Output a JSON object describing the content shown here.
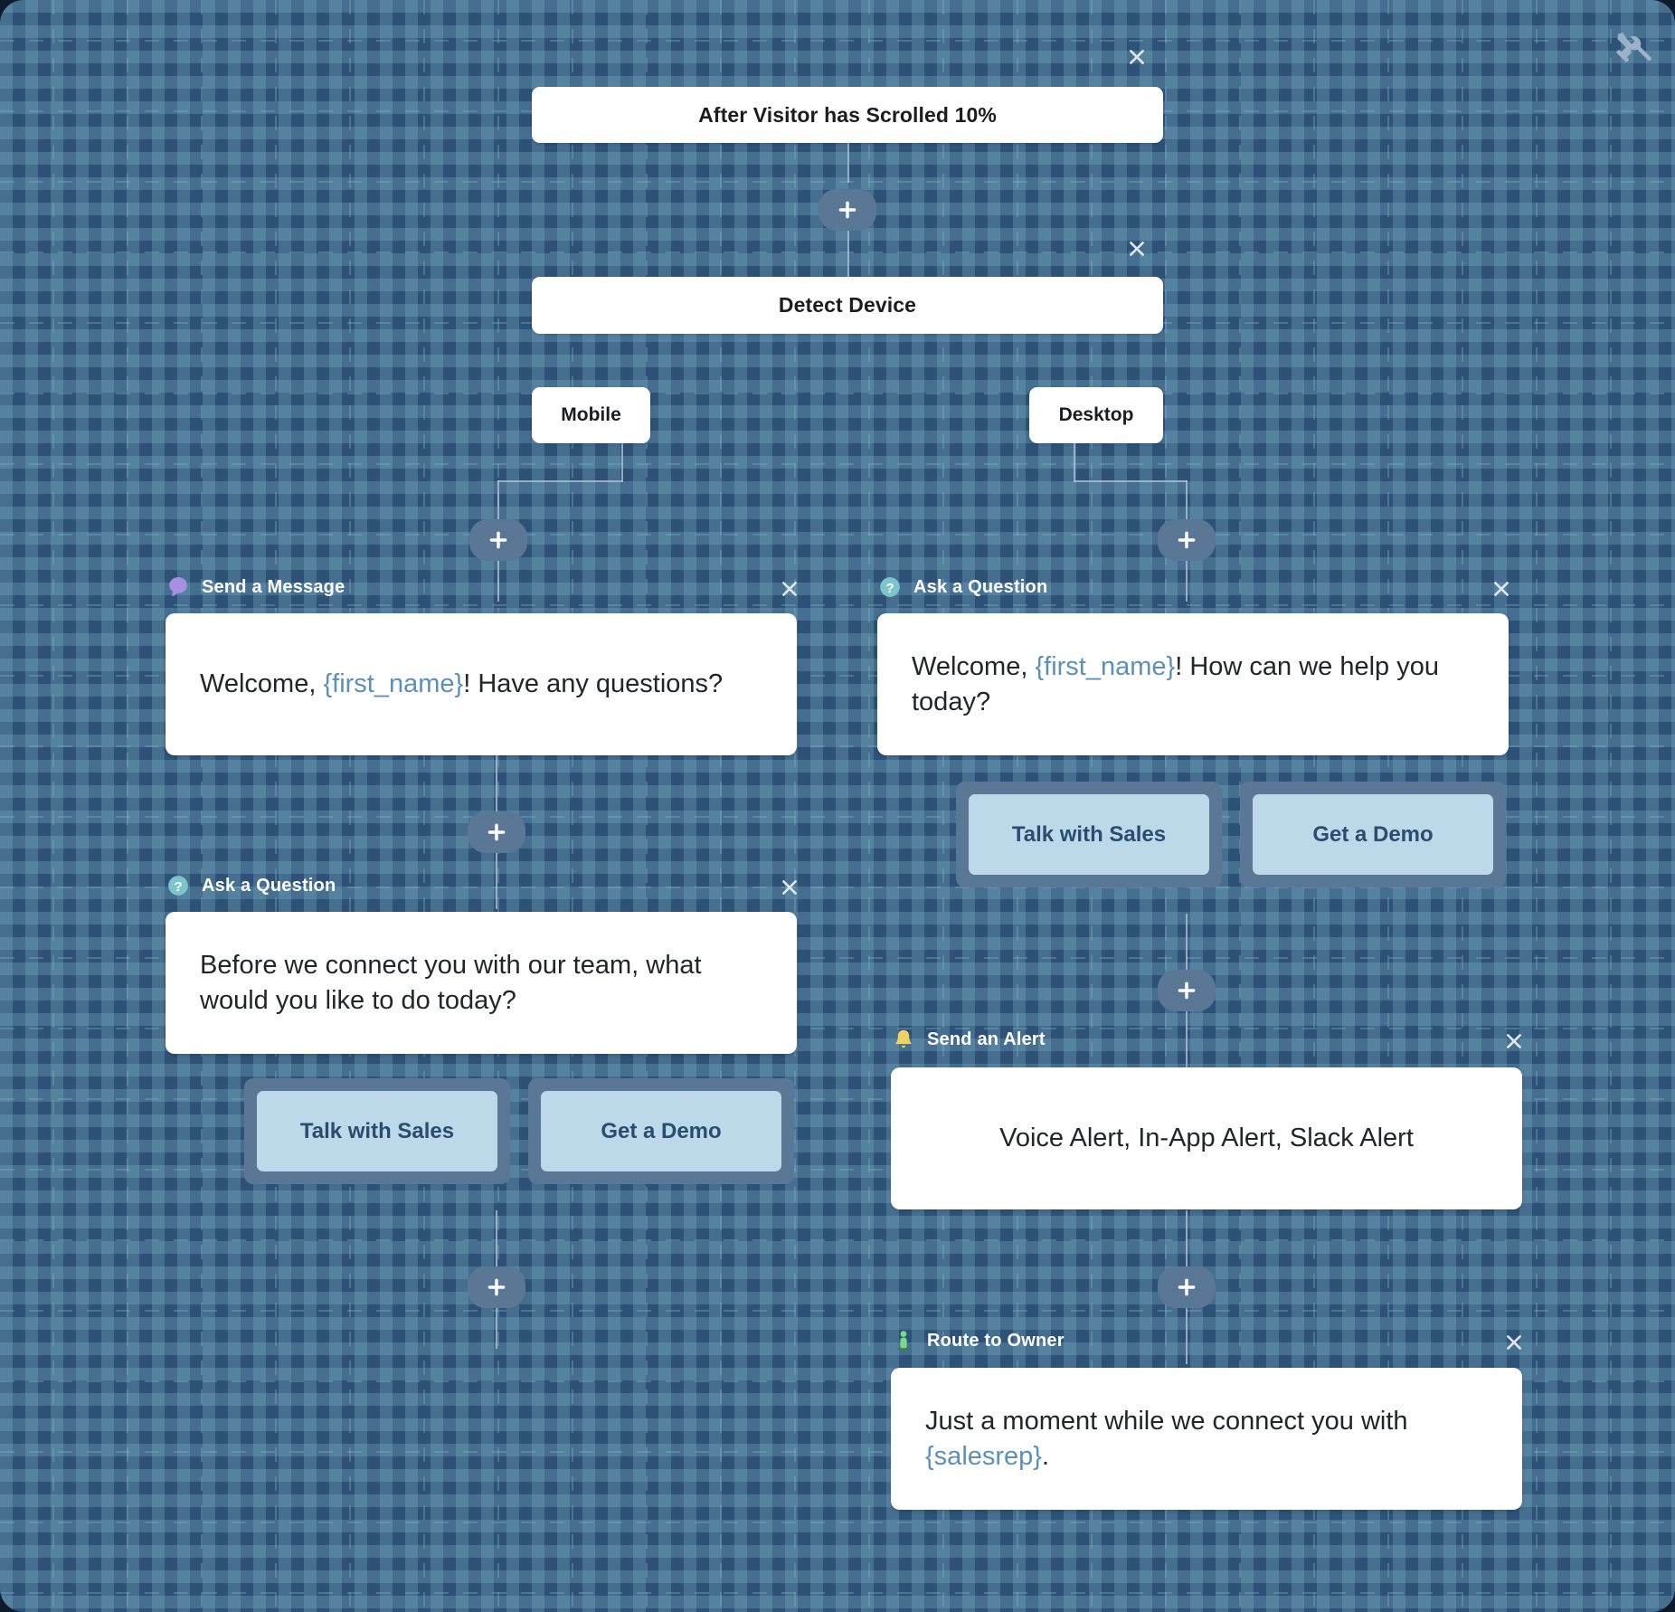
{
  "app": {
    "background_color": "#2d5177",
    "grid_color": "#7db0c8",
    "tools_icon": "tools-wrench-screwdriver-icon"
  },
  "trigger": {
    "label": "After Visitor has Scrolled 10%",
    "close_label": "×"
  },
  "condition": {
    "label": "Detect Device",
    "close_label": "×",
    "branches": [
      {
        "label": "Mobile"
      },
      {
        "label": "Desktop"
      }
    ]
  },
  "steps": {
    "mobile_send_message": {
      "icon": "speech-bubble-icon",
      "icon_color": "#a98fe0",
      "title": "Send a Message",
      "body_prefix": "Welcome, ",
      "body_variable": "{first_name}",
      "body_suffix": "! Have any questions?",
      "close_label": "×"
    },
    "mobile_ask_question": {
      "icon": "question-mark-circle-icon",
      "icon_color": "#7cc5ca",
      "title": "Ask a Question",
      "body": "Before we connect you with our team, what would you like to do today?",
      "close_label": "×",
      "replies": [
        {
          "label": "Talk with Sales"
        },
        {
          "label": "Get a Demo"
        }
      ]
    },
    "desktop_ask_question": {
      "icon": "question-mark-circle-icon",
      "icon_color": "#7cc5ca",
      "title": "Ask a Question",
      "body_prefix": "Welcome, ",
      "body_variable": "{first_name}",
      "body_suffix": "! How can we help you today?",
      "close_label": "×",
      "replies": [
        {
          "label": "Talk with Sales"
        },
        {
          "label": "Get a Demo"
        }
      ]
    },
    "desktop_send_alert": {
      "icon": "bell-icon",
      "icon_color": "#f0d264",
      "title": "Send an Alert",
      "body": "Voice Alert, In-App Alert, Slack Alert",
      "close_label": "×"
    },
    "desktop_route_owner": {
      "icon": "person-icon",
      "icon_color": "#79d98a",
      "title": "Route to Owner",
      "body_prefix": "Just a moment while we connect you with ",
      "body_variable": "{salesrep}",
      "body_suffix": ".",
      "close_label": "×"
    }
  },
  "add_buttons": [
    {
      "name": "add-step-after-trigger"
    },
    {
      "name": "add-step-mobile-branch"
    },
    {
      "name": "add-step-desktop-branch"
    },
    {
      "name": "add-step-after-mobile-message"
    },
    {
      "name": "add-step-after-mobile-question"
    },
    {
      "name": "add-step-after-desktop-question"
    },
    {
      "name": "add-step-after-desktop-alert"
    }
  ]
}
